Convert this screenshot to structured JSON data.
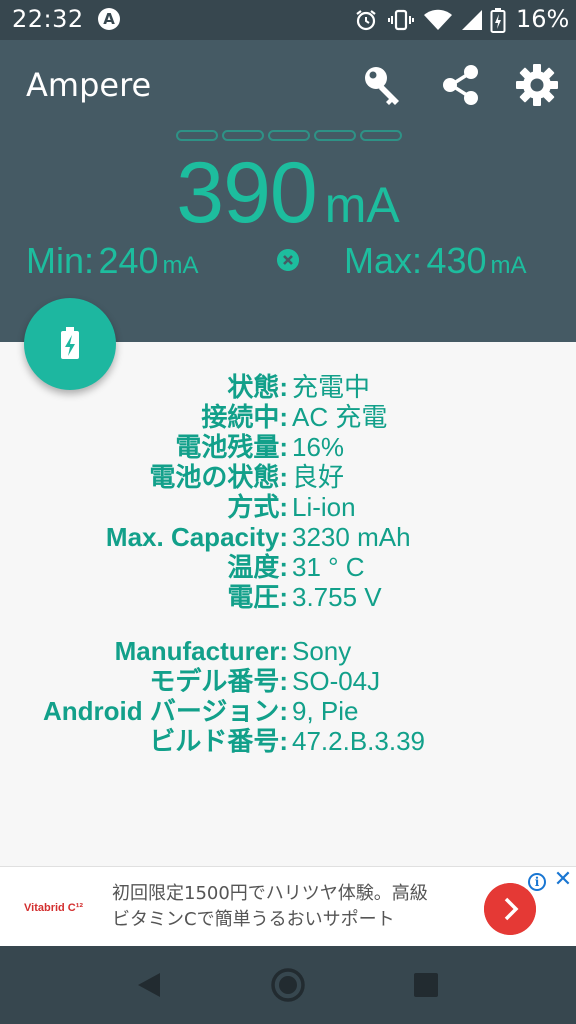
{
  "status_bar": {
    "time": "22:32",
    "notification_badge": "A",
    "battery_percent": "16%",
    "icons": [
      "alarm-icon",
      "vibrate-icon",
      "wifi-icon",
      "cell-signal-icon",
      "battery-icon"
    ]
  },
  "app_bar": {
    "title": "Ampere",
    "actions": [
      "key-icon",
      "share-icon",
      "settings-icon"
    ]
  },
  "meter": {
    "current_value": "390",
    "current_unit": "mA",
    "min_label": "Min:",
    "min_value": "240",
    "max_label": "Max:",
    "max_value": "430",
    "unit": "mA",
    "segments": 5
  },
  "info": {
    "rows": [
      {
        "key": "状態:",
        "value": "充電中"
      },
      {
        "key": "接続中:",
        "value": "AC 充電"
      },
      {
        "key": "電池残量:",
        "value": "16%"
      },
      {
        "key": "電池の状態:",
        "value": "良好"
      },
      {
        "key": "方式:",
        "value": "Li-ion"
      },
      {
        "key": "Max. Capacity:",
        "value": "3230 mAh"
      },
      {
        "key": "温度:",
        "value": "31 ° C"
      },
      {
        "key": "電圧:",
        "value": "3.755 V"
      }
    ],
    "device_rows": [
      {
        "key": "Manufacturer:",
        "value": "Sony"
      },
      {
        "key": "モデル番号:",
        "value": "SO-04J"
      },
      {
        "key": "Android バージョン:",
        "value": "9, Pie"
      },
      {
        "key": "ビルド番号:",
        "value": "47.2.B.3.39"
      }
    ]
  },
  "ad": {
    "brand": "Vitabrid C¹²",
    "line1": "初回限定1500円でハリツヤ体験。高級",
    "line2": "ビタミンCで簡単うるおいサポート",
    "info_glyph": "i",
    "close_glyph": "✕"
  },
  "colors": {
    "header_bg": "#455a64",
    "status_bg": "#37474f",
    "accent": "#1dbd9e",
    "text_teal": "#12a08a",
    "ad_button": "#e53935"
  }
}
